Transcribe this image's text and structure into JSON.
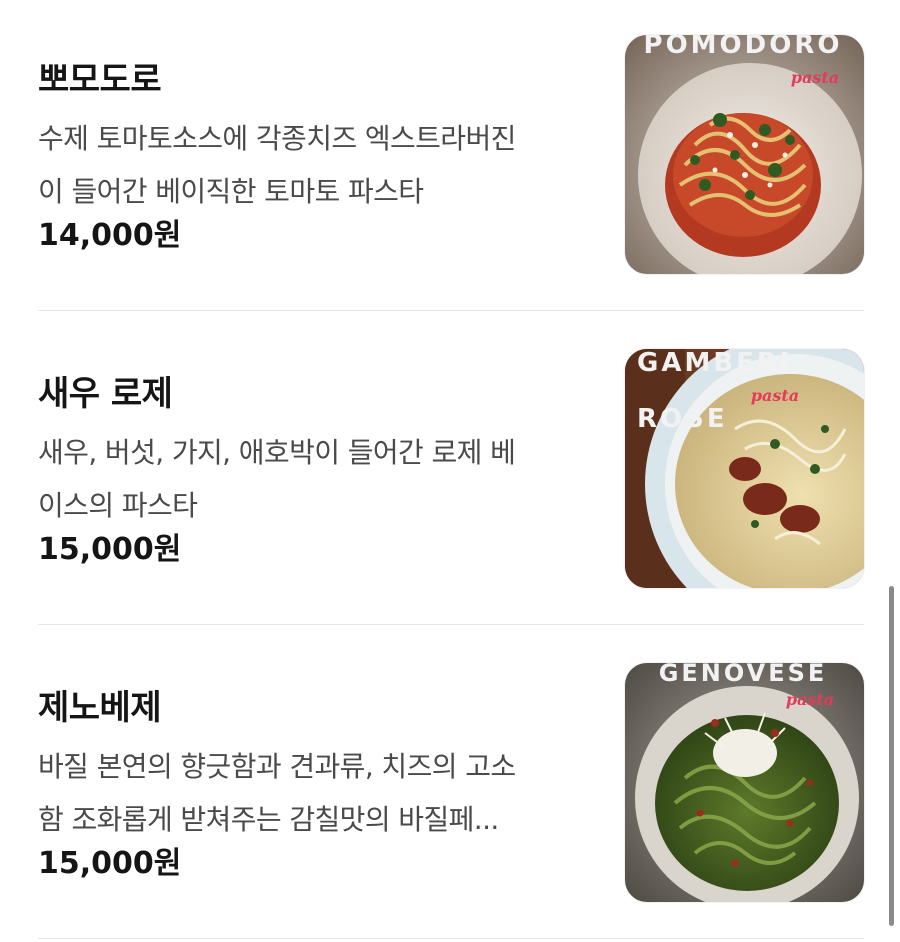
{
  "menu": {
    "items": [
      {
        "name": "뽀모도로",
        "description_lines": [
          "수제 토마토소스에 각종치즈 엑스트라버진",
          "이 들어간 베이직한 토마토 파스타"
        ],
        "price": "14,000원",
        "photo_title_lines": [
          "POMODORO"
        ],
        "photo_script": "pasta"
      },
      {
        "name": "새우 로제",
        "description_lines": [
          "새우, 버섯, 가지, 애호박이 들어간 로제 베",
          "이스의 파스타"
        ],
        "price": "15,000원",
        "photo_title_lines": [
          "GAMBERI",
          "ROSE"
        ],
        "photo_script": "pasta"
      },
      {
        "name": "제노베제",
        "description_lines": [
          "바질 본연의 향긋함과 견과류, 치즈의 고소",
          "함 조화롭게 받쳐주는 감칠맛의 바질페..."
        ],
        "price": "15,000원",
        "photo_title_lines": [
          "GENOVESE"
        ],
        "photo_script": "pasta"
      }
    ]
  },
  "colors": {
    "text_primary": "#151515",
    "text_secondary": "#4a4a4a",
    "divider": "#e8e8e8",
    "scrollbar": "#8a8a8a",
    "photo_script_pink": "#e23b5c"
  }
}
